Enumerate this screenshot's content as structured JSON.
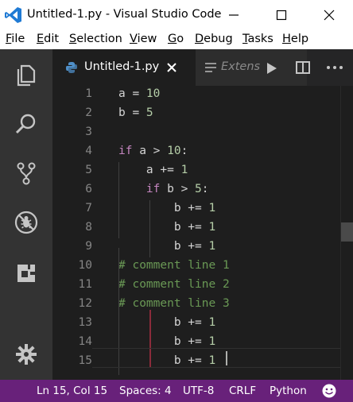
{
  "window": {
    "title": "Untitled-1.py - Visual Studio Code"
  },
  "menu": [
    {
      "mn": "F",
      "rest": "ile"
    },
    {
      "mn": "E",
      "rest": "dit"
    },
    {
      "mn": "S",
      "rest": "election"
    },
    {
      "mn": "V",
      "rest": "iew"
    },
    {
      "mn": "G",
      "rest": "o"
    },
    {
      "mn": "D",
      "rest": "ebug"
    },
    {
      "mn": "T",
      "rest": "asks"
    },
    {
      "mn": "H",
      "rest": "elp"
    }
  ],
  "tabs": {
    "active": "Untitled-1.py",
    "inactive": "Extens"
  },
  "editor": {
    "line_numbers": [
      "1",
      "2",
      "3",
      "4",
      "5",
      "6",
      "7",
      "8",
      "9",
      "10",
      "11",
      "12",
      "13",
      "14",
      "15"
    ],
    "lines": [
      [
        {
          "t": "a = ",
          "c": ""
        },
        {
          "t": "10",
          "c": "num"
        }
      ],
      [
        {
          "t": "b = ",
          "c": ""
        },
        {
          "t": "5",
          "c": "num"
        }
      ],
      [],
      [
        {
          "t": "if",
          "c": "kw"
        },
        {
          "t": " a > ",
          "c": ""
        },
        {
          "t": "10",
          "c": "num"
        },
        {
          "t": ":",
          "c": ""
        }
      ],
      [
        {
          "t": "    a += ",
          "c": ""
        },
        {
          "t": "1",
          "c": "num"
        }
      ],
      [
        {
          "t": "    ",
          "c": ""
        },
        {
          "t": "if",
          "c": "kw"
        },
        {
          "t": " b > ",
          "c": ""
        },
        {
          "t": "5",
          "c": "num"
        },
        {
          "t": ":",
          "c": ""
        }
      ],
      [
        {
          "t": "        b += ",
          "c": ""
        },
        {
          "t": "1",
          "c": "num"
        }
      ],
      [
        {
          "t": "        b += ",
          "c": ""
        },
        {
          "t": "1",
          "c": "num"
        }
      ],
      [
        {
          "t": "        b += ",
          "c": ""
        },
        {
          "t": "1",
          "c": "num"
        }
      ],
      [
        {
          "t": "# comment line 1",
          "c": "cm"
        }
      ],
      [
        {
          "t": "# comment line 2",
          "c": "cm"
        }
      ],
      [
        {
          "t": "# comment line 3",
          "c": "cm"
        }
      ],
      [
        {
          "t": "        b += ",
          "c": ""
        },
        {
          "t": "1",
          "c": "num"
        }
      ],
      [
        {
          "t": "        b += ",
          "c": ""
        },
        {
          "t": "1",
          "c": "num"
        }
      ],
      [
        {
          "t": "        b += ",
          "c": ""
        },
        {
          "t": "1",
          "c": "num"
        }
      ]
    ]
  },
  "status": {
    "position": "Ln 15, Col 15",
    "spaces": "Spaces: 4",
    "encoding": "UTF-8",
    "eol": "CRLF",
    "language": "Python"
  },
  "colors": {
    "statusbar": "#68217a",
    "activitybar": "#333333",
    "editor_bg": "#1e1e1e",
    "keyword": "#c586c0",
    "number": "#b5cea8",
    "comment": "#6a9955"
  },
  "icons": [
    "vscode-logo-icon",
    "minimize-icon",
    "maximize-icon",
    "close-icon",
    "explorer-icon",
    "search-icon",
    "source-control-icon",
    "debug-icon",
    "extensions-icon",
    "settings-gear-icon",
    "python-file-icon",
    "tab-close-icon",
    "preview-icon",
    "run-icon",
    "split-editor-icon",
    "more-actions-icon",
    "feedback-smiley-icon"
  ]
}
